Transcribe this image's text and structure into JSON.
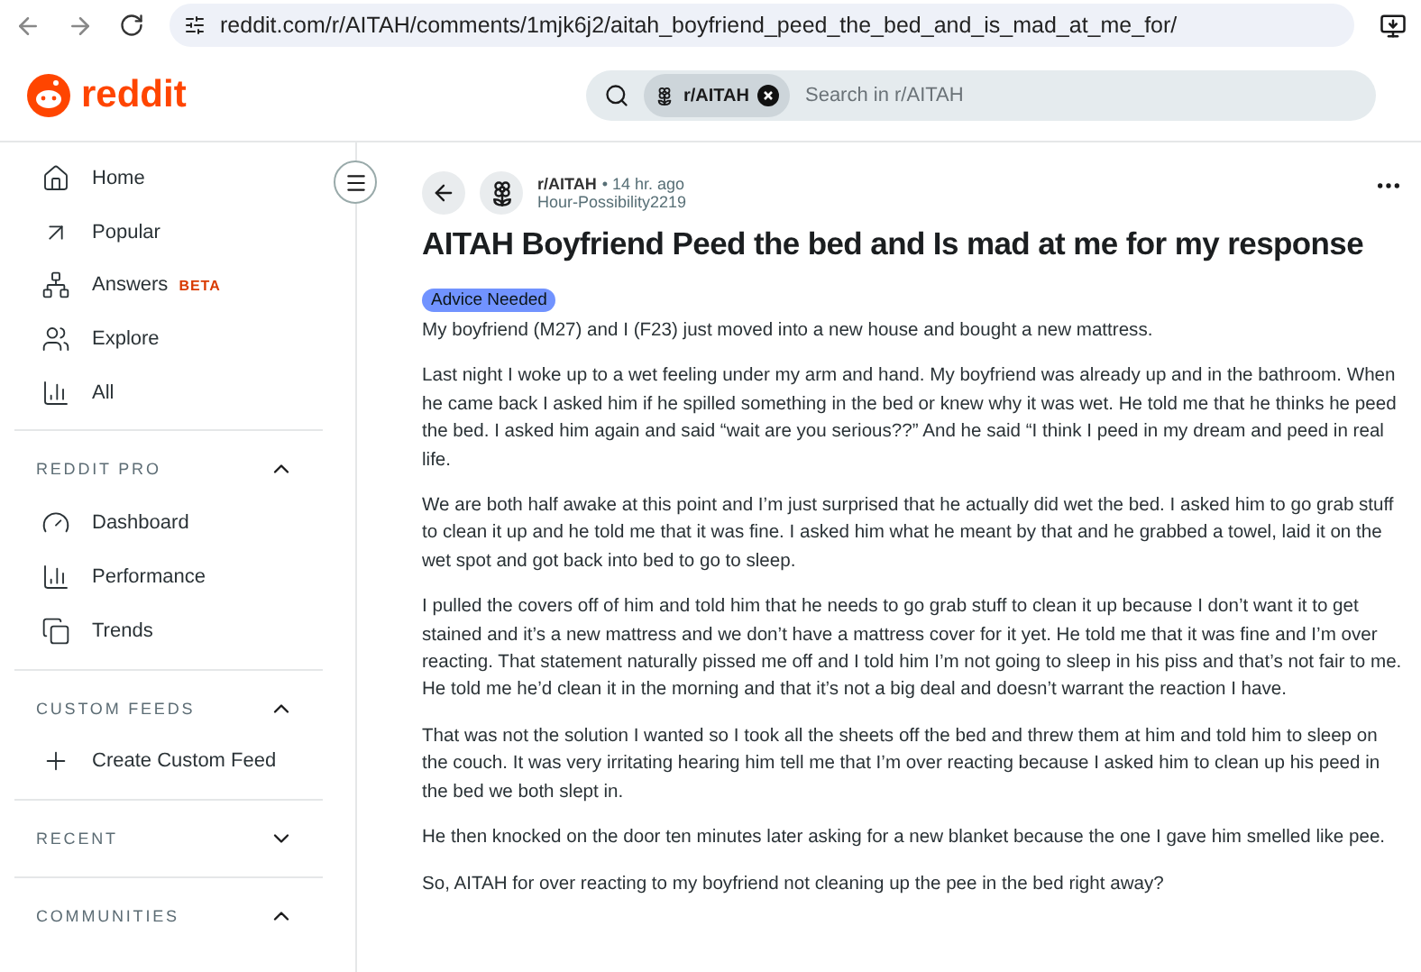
{
  "browser": {
    "url": "reddit.com/r/AITAH/comments/1mjk6j2/aitah_boyfriend_peed_the_bed_and_is_mad_at_me_for/"
  },
  "header": {
    "logo": "reddit",
    "search": {
      "chip": "r/AITAH",
      "placeholder": "Search in r/AITAH"
    }
  },
  "sidebar": {
    "items": [
      {
        "label": "Home"
      },
      {
        "label": "Popular"
      },
      {
        "label": "Answers",
        "badge": "BETA"
      },
      {
        "label": "Explore"
      },
      {
        "label": "All"
      }
    ],
    "sections": [
      {
        "title": "REDDIT PRO",
        "expanded": true,
        "items": [
          {
            "label": "Dashboard"
          },
          {
            "label": "Performance"
          },
          {
            "label": "Trends"
          }
        ]
      },
      {
        "title": "CUSTOM FEEDS",
        "expanded": true,
        "items": [
          {
            "label": "Create Custom Feed"
          }
        ]
      },
      {
        "title": "RECENT",
        "expanded": false
      },
      {
        "title": "COMMUNITIES",
        "expanded": true
      }
    ]
  },
  "post": {
    "subreddit": "r/AITAH",
    "time": "• 14 hr. ago",
    "author": "Hour-Possibility2219",
    "title": "AITAH Boyfriend Peed the bed and Is mad at me for my response",
    "flair": "Advice Needed",
    "paragraphs": [
      "My boyfriend (M27) and I (F23) just moved into a new house and bought a new mattress.",
      "Last night I woke up to a wet feeling under my arm and hand. My boyfriend was already up and in the bathroom. When he came back I asked him if he spilled something in the bed or knew why it was wet. He told me that he thinks he peed the bed. I asked him again and said “wait are you serious??” And he said “I think I peed in my dream and peed in real life.",
      "We are both half awake at this point and I’m just surprised that he actually did wet the bed. I asked him to go grab stuff to clean it up and he told me that it was fine. I asked him what he meant by that and he grabbed a towel, laid it on the wet spot and got back into bed to go to sleep.",
      "I pulled the covers off of him and told him that he needs to go grab stuff to clean it up because I don’t want it to get stained and it’s a new mattress and we don’t have a mattress cover for it yet. He told me that it was fine and I’m over reacting. That statement naturally pissed me off and I told him I’m not going to sleep in his piss and that’s not fair to me. He told me he’d clean it in the morning and that it’s not a big deal and doesn’t warrant the reaction I have.",
      "That was not the solution I wanted so I took all the sheets off the bed and threw them at him and told him to sleep on the couch. It was very irritating hearing him tell me that I’m over reacting because I asked him to clean up his peed in the bed we both slept in.",
      "He then knocked on the door ten minutes later asking for a new blanket because the one I gave him smelled like pee.",
      "So, AITAH for over reacting to my boyfriend not cleaning up the pee in the bed right away?"
    ]
  }
}
